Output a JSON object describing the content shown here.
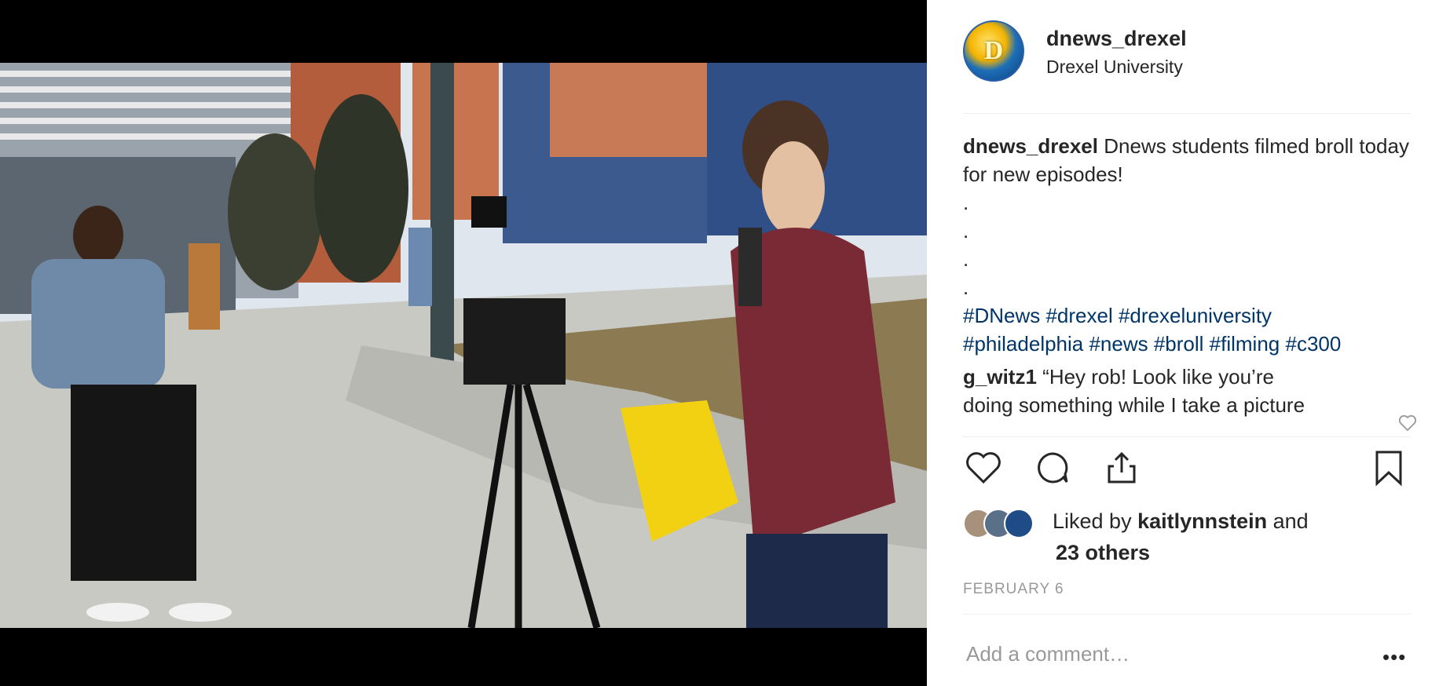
{
  "post": {
    "username": "dnews_drexel",
    "location": "Drexel University",
    "avatar_text": "D"
  },
  "caption": {
    "username": "dnews_drexel",
    "text": "Dnews students filmed broll today for new episodes!",
    "dots": [
      ".",
      ".",
      ".",
      "."
    ],
    "hashtags_line1": "#DNews #drexel #drexeluniversity",
    "hashtags_line2": "#philadelphia #news #broll #filming #c300"
  },
  "comment": {
    "username": "g_witz1",
    "text_line1": "“Hey rob! Look like you’re",
    "text_line2": "doing something while I take a picture"
  },
  "likes": {
    "prefix": "Liked by ",
    "user": "kaitlynnstein",
    "suffix": " and",
    "others": "23 others"
  },
  "date": "FEBRUARY 6",
  "add_comment_placeholder": "Add a comment…",
  "more_label": "•••",
  "icons": [
    "heart-icon",
    "comment-icon",
    "share-icon",
    "bookmark-icon",
    "small-heart-icon"
  ],
  "colors": {
    "hashtag": "#003569",
    "text": "#262626",
    "muted": "#999999",
    "divider": "#efefef"
  }
}
